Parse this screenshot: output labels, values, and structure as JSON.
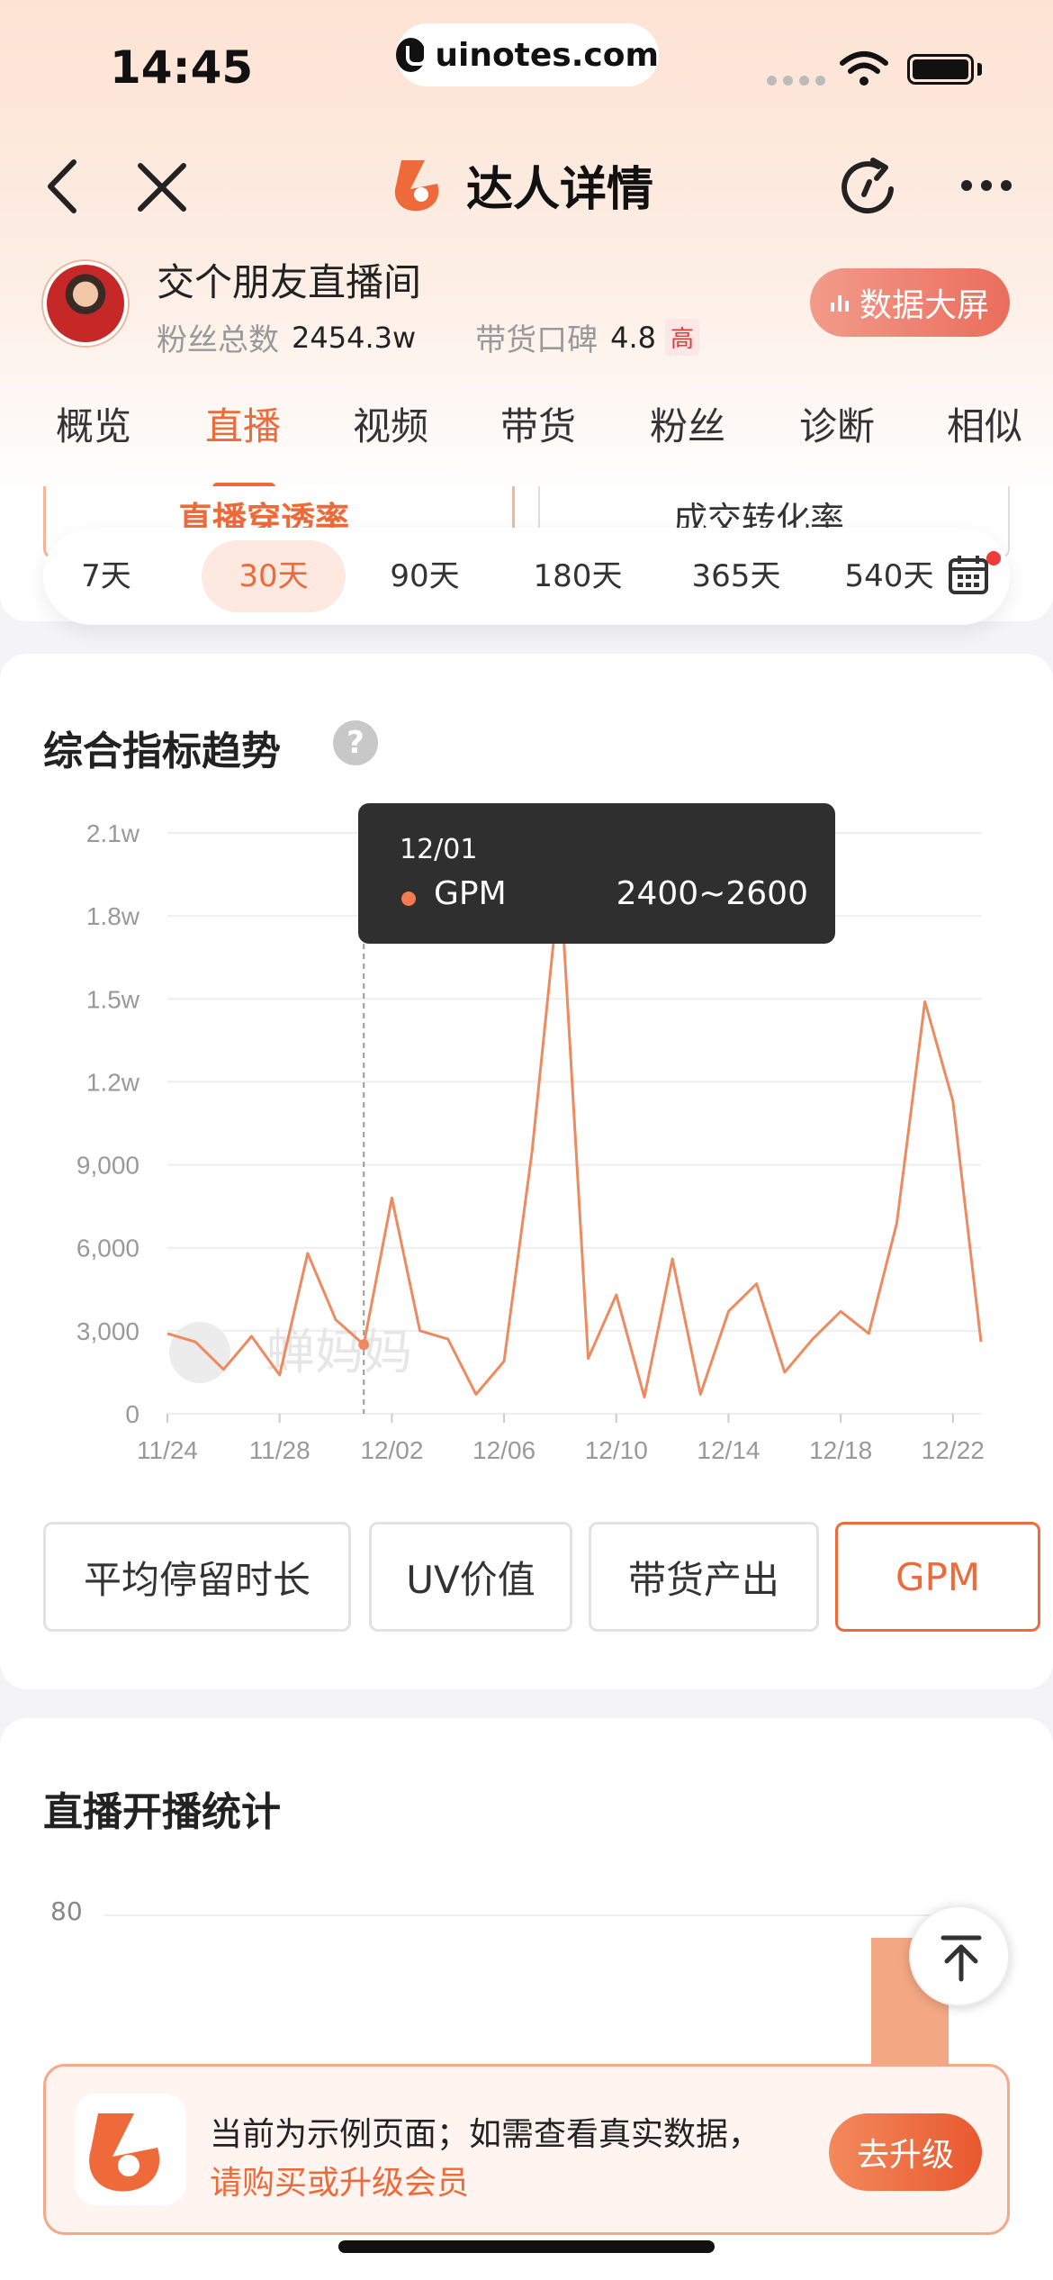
{
  "status_bar": {
    "time": "14:45",
    "url": "uinotes.com"
  },
  "nav": {
    "title": "达人详情",
    "icons": [
      "back-icon",
      "close-icon",
      "refresh-icon",
      "more-icon"
    ]
  },
  "profile": {
    "name": "交个朋友直播间",
    "fans_label": "粉丝总数",
    "fans_value": "2454.3w",
    "reputation_label": "带货口碑",
    "reputation_value": "4.8",
    "reputation_badge": "高",
    "big_screen_label": "数据大屏"
  },
  "tabs": [
    "概览",
    "直播",
    "视频",
    "带货",
    "粉丝",
    "诊断",
    "相似"
  ],
  "active_tab": "直播",
  "metric_cards": [
    "直播穿透率",
    "成交转化率"
  ],
  "date_ranges": [
    "7天",
    "30天",
    "90天",
    "180天",
    "365天",
    "540天"
  ],
  "active_date_range": "30天",
  "trend_section": {
    "title": "综合指标趋势",
    "help": "?",
    "watermark": "蝉妈妈",
    "tooltip": {
      "date": "12/01",
      "series": "GPM",
      "value": "2400~2600"
    },
    "buttons": [
      "平均停留时长",
      "UV价值",
      "带货产出",
      "GPM"
    ],
    "active_button": "GPM"
  },
  "chart_data": {
    "type": "line",
    "series": [
      {
        "name": "GPM",
        "values": [
          2900,
          2600,
          1600,
          2800,
          1400,
          5800,
          3400,
          2500,
          7800,
          3000,
          2700,
          700,
          1900,
          9500,
          19400,
          2000,
          4300,
          600,
          5600,
          700,
          3700,
          4700,
          1500,
          2700,
          3700,
          2900,
          6900,
          14900,
          11300,
          2600
        ]
      }
    ],
    "x_tick_labels": [
      "11/24",
      "11/28",
      "12/02",
      "12/06",
      "12/10",
      "12/14",
      "12/18",
      "12/22"
    ],
    "y_tick_labels": [
      "0",
      "3,000",
      "6,000",
      "9,000",
      "1.2w",
      "1.5w",
      "1.8w",
      "2.1w"
    ],
    "ylim": [
      0,
      21000
    ],
    "grid": true,
    "color": "#ee8a60",
    "highlight_date": "12/01"
  },
  "live_section": {
    "title": "直播开播统计",
    "y_top_label": "80",
    "back_top_icon": "arrow-up-icon"
  },
  "banner": {
    "line1": "当前为示例页面；如需查看真实数据，",
    "line2": "请购买或升级会员",
    "button": "去升级"
  },
  "colors": {
    "accent": "#ef6a3a",
    "tooltip_bg": "#2f2f2f"
  }
}
